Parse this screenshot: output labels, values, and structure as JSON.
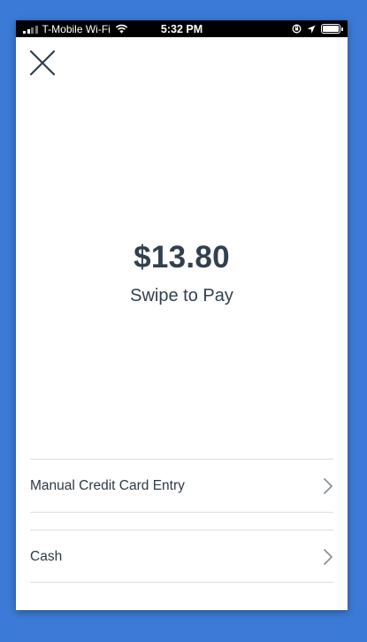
{
  "status_bar": {
    "carrier": "T-Mobile Wi-Fi",
    "time": "5:32 PM",
    "icons": [
      "signal-icon",
      "wifi-icon",
      "orientation-lock-icon",
      "location-icon",
      "battery-icon"
    ]
  },
  "header": {
    "close_icon": "close-icon"
  },
  "payment": {
    "amount": "$13.80",
    "instruction": "Swipe to Pay"
  },
  "options": [
    {
      "label": "Manual Credit Card Entry",
      "icon": "chevron-right-icon"
    },
    {
      "label": "Cash",
      "icon": "chevron-right-icon"
    }
  ],
  "colors": {
    "background": "#3b7ad6",
    "text": "#33404d",
    "divider": "#dcdcdc"
  }
}
